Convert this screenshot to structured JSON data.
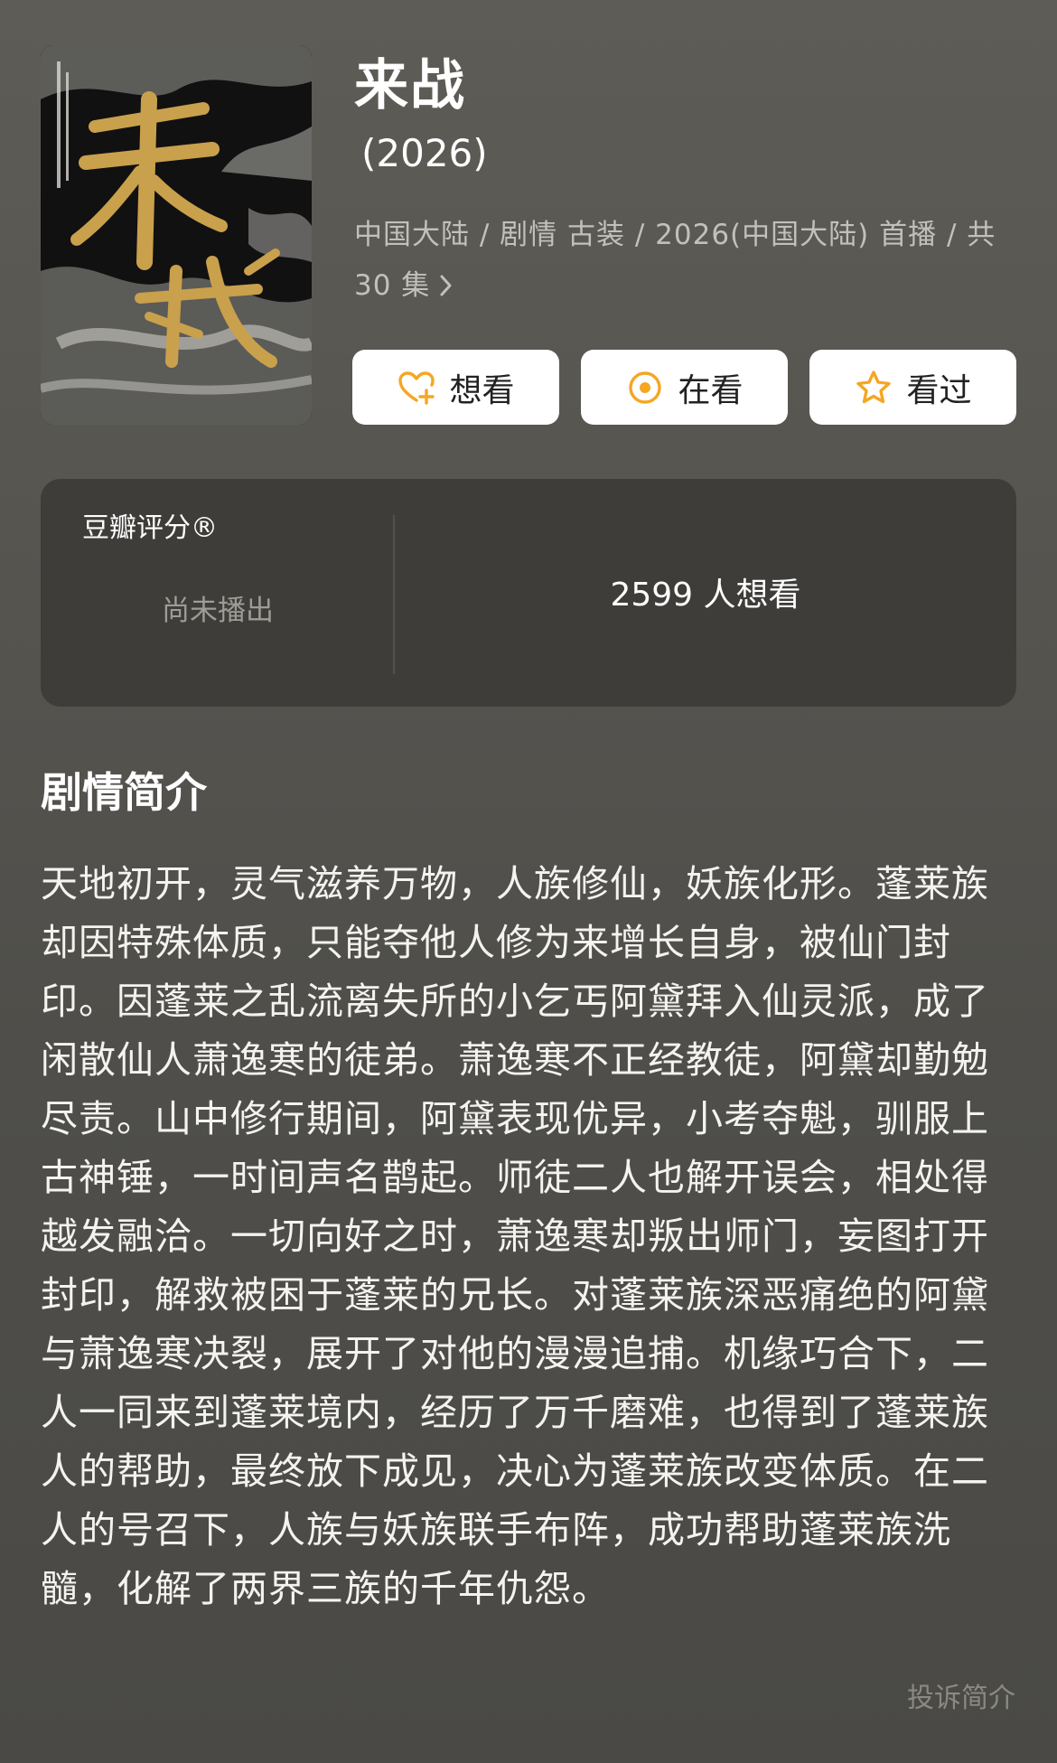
{
  "movie": {
    "poster_alt": "来战",
    "title": "来战",
    "year": "(2026)",
    "meta_line1": "中国大陆 / 剧情 古装 / 2026(中国大陆) 首播 / 共",
    "meta_line2": "30 集"
  },
  "actions": [
    {
      "label": "想看",
      "icon": "heart-plus-icon"
    },
    {
      "label": "在看",
      "icon": "target-circle-icon"
    },
    {
      "label": "看过",
      "icon": "star-icon"
    }
  ],
  "rating": {
    "label": "豆瓣评分®",
    "status": "尚未播出",
    "wish_count": "2599 人想看"
  },
  "synopsis": {
    "title": "剧情简介",
    "text": "天地初开，灵气滋养万物，人族修仙，妖族化形。蓬莱族却因特殊体质，只能夺他人修为来增长自身，被仙门封印。因蓬莱之乱流离失所的小乞丐阿黛拜入仙灵派，成了闲散仙人萧逸寒的徒弟。萧逸寒不正经教徒，阿黛却勤勉尽责。山中修行期间，阿黛表现优异，小考夺魁，驯服上古神锤，一时间声名鹊起。师徒二人也解开误会，相处得越发融洽。一切向好之时，萧逸寒却叛出师门，妄图打开封印，解救被困于蓬莱的兄长。对蓬莱族深恶痛绝的阿黛与萧逸寒决裂，展开了对他的漫漫追捕。机缘巧合下，二人一同来到蓬莱境内，经历了万千磨难，也得到了蓬莱族人的帮助，最终放下成见，决心为蓬莱族改变体质。在二人的号召下，人族与妖族联手布阵，成功帮助蓬莱族洗髓，化解了两界三族的千年仇怨。",
    "report_label": "投诉简介"
  },
  "colors": {
    "accent": "#f5a623",
    "background": "#55544f",
    "card": "#3e3d3a"
  }
}
